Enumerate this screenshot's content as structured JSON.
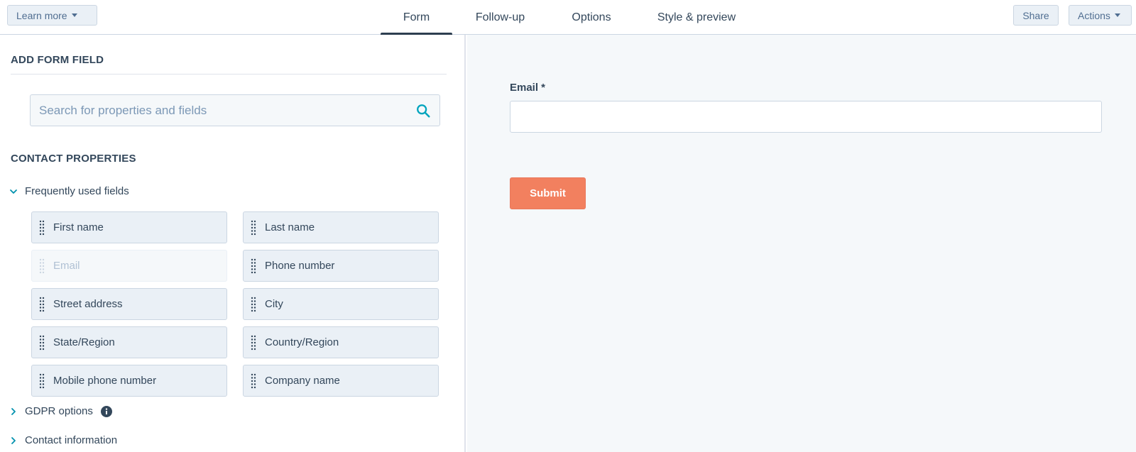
{
  "header": {
    "learn_more": "Learn more",
    "tabs": [
      {
        "label": "Form"
      },
      {
        "label": "Follow-up"
      },
      {
        "label": "Options"
      },
      {
        "label": "Style & preview"
      }
    ],
    "share": "Share",
    "actions": "Actions"
  },
  "left": {
    "add_form_field": "ADD FORM FIELD",
    "search_placeholder": "Search for properties and fields",
    "contact_properties": "CONTACT PROPERTIES",
    "frequent_group": "Frequently used fields",
    "fields": [
      {
        "label": "First name"
      },
      {
        "label": "Last name"
      },
      {
        "label": "Email"
      },
      {
        "label": "Phone number"
      },
      {
        "label": "Street address"
      },
      {
        "label": "City"
      },
      {
        "label": "State/Region"
      },
      {
        "label": "Country/Region"
      },
      {
        "label": "Mobile phone number"
      },
      {
        "label": "Company name"
      }
    ],
    "gdpr_group": "GDPR options",
    "contact_info_group": "Contact information"
  },
  "preview": {
    "email_label": "Email *",
    "submit": "Submit"
  },
  "colors": {
    "accent": "#f2805f",
    "active_tab": "#2d3e50",
    "field_bg": "#eaf0f6",
    "preview_bg": "#f5f8fa"
  }
}
